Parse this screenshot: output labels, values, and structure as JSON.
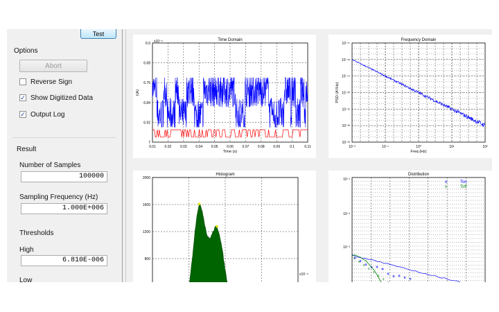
{
  "left_panel": {
    "test_button": "Test",
    "options_label": "Options",
    "abort_button": "Abort",
    "checkboxes": [
      {
        "label": "Reverse Sign",
        "checked": false
      },
      {
        "label": "Show Digitized Data",
        "checked": true
      },
      {
        "label": "Output Log",
        "checked": true
      }
    ],
    "checkmark": "✓",
    "result_label": "Result",
    "num_samples_label": "Number of Samples",
    "num_samples_value": "100000",
    "sampling_freq_label": "Sampling Frequency (Hz)",
    "sampling_freq_value": "1.000E+006",
    "thresholds_label": "Thresholds",
    "high_label": "High",
    "high_value": "6.810E-006",
    "low_label": "Low"
  },
  "chart_data": [
    {
      "type": "line",
      "title": "Time Domain",
      "xlabel": "Time (s)",
      "ylabel": "I(A)",
      "y_exponent": "x10⁻⁶",
      "x_ticks": [
        "0.01",
        "0.02",
        "0.03",
        "0.04",
        "0.05",
        "0.06",
        "0.07",
        "0.08",
        "0.09",
        "0.1",
        "0.11"
      ],
      "y_ticks": [
        "6.6",
        "6.68",
        "6.76",
        "6.84",
        "6.92",
        "7"
      ],
      "xlim": [
        0.01,
        0.11
      ],
      "ylim": [
        6.6,
        7.0
      ],
      "series": [
        {
          "color": "#0000ff",
          "band": [
            6.66,
            6.86
          ]
        },
        {
          "color": "#ff0000",
          "band": [
            6.62,
            6.65
          ]
        }
      ],
      "grid": true
    },
    {
      "type": "line",
      "title": "Frequency Domain",
      "xlabel": "Freq (Hz)",
      "ylabel": "PSD (A²/Hz)",
      "x_ticks": [
        "10⁻²",
        "10⁻¹",
        "10⁰",
        "10¹",
        "10²"
      ],
      "y_ticks": [
        "10⁻¹⁷",
        "10⁻¹⁸",
        "10⁻¹⁹",
        "10⁻²⁰",
        "10⁻²¹",
        "10⁻²²",
        "10⁻²³"
      ],
      "x_log": true,
      "y_log": true,
      "series": [
        {
          "color": "#0000ff",
          "x": [
            0.01,
            100
          ],
          "y": [
            1e-18,
            1e-22
          ]
        }
      ],
      "grid": true
    },
    {
      "type": "area",
      "title": "Histogram",
      "y_ticks": [
        "2000",
        "1600",
        "1200",
        "800",
        "400"
      ],
      "x_exponent": "x10⁻⁶",
      "ylim": [
        0,
        2000
      ],
      "peaks": [
        1350,
        1050
      ],
      "colors": {
        "fill": "#006400",
        "marker": "#e6e600"
      },
      "grid": true
    },
    {
      "type": "scatter",
      "title": "Distribution",
      "y_ticks": [
        "10⁻¹",
        "10⁻²",
        "10⁻³"
      ],
      "y_log": true,
      "legend": [
        {
          "marker": "o",
          "name": "Ton",
          "color": "#0000ff"
        },
        {
          "marker": "x",
          "name": "Toff",
          "color": "#008000"
        }
      ],
      "grid": true
    }
  ]
}
